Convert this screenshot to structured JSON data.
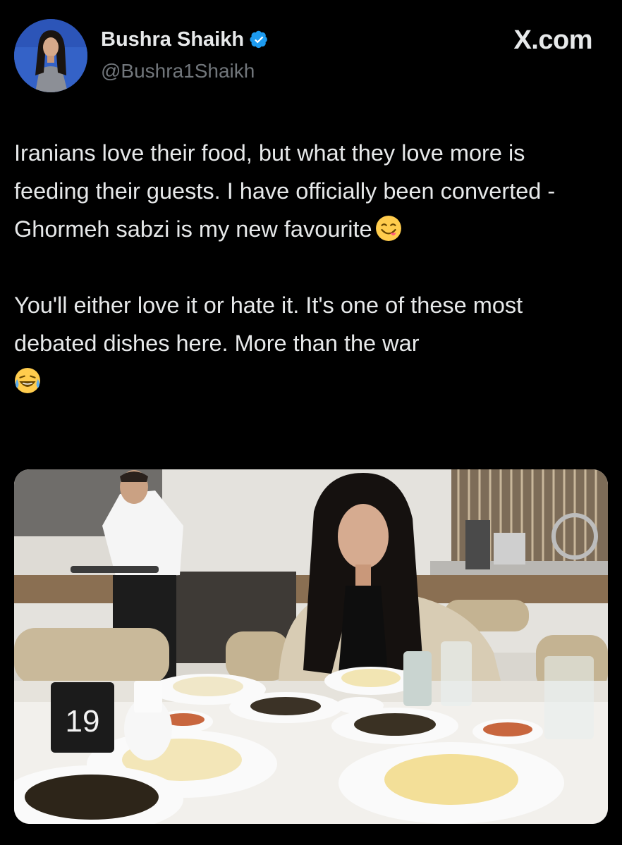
{
  "author": {
    "display_name": "Bushra Shaikh",
    "handle": "@Bushra1Shaikh",
    "verified": true
  },
  "brand": {
    "label": "X.com"
  },
  "post": {
    "paragraph_1": "Iranians love their food, but what they love more is feeding their guests. I have officially been converted - Ghormeh sabzi is my new favourite",
    "paragraph_1_emoji": "yum-face-emoji",
    "paragraph_2": "You'll either love it or hate it. It's one of these most debated dishes here. More than the war",
    "paragraph_2_emoji": "tears-of-joy-emoji"
  },
  "media": {
    "table_number": "19"
  },
  "colors": {
    "background": "#000000",
    "text_primary": "#e7e9ea",
    "text_secondary": "#71767b",
    "verified_blue": "#1d9bf0"
  }
}
